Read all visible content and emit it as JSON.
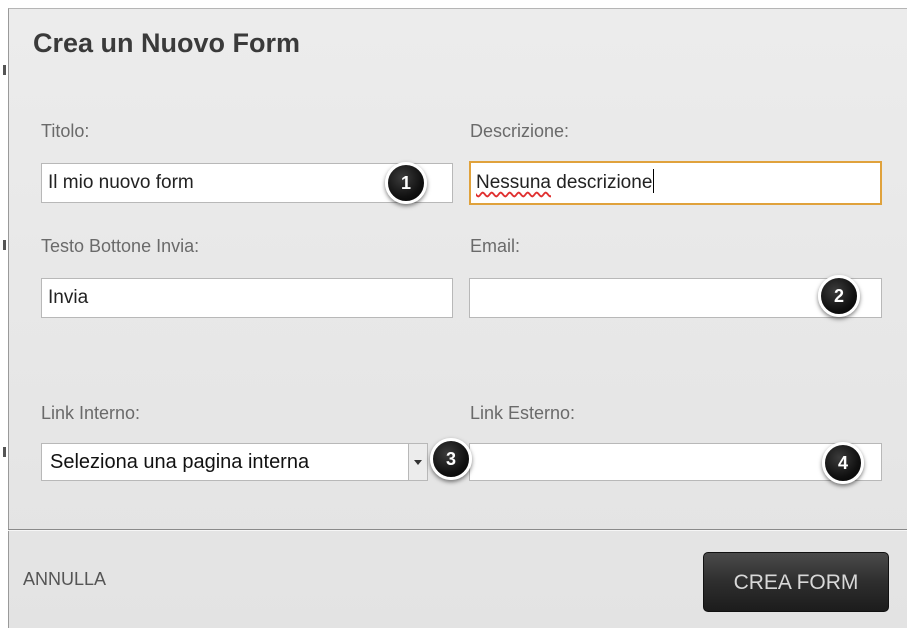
{
  "dialog": {
    "title": "Crea un Nuovo Form"
  },
  "fields": {
    "titolo": {
      "label": "Titolo:",
      "value": "Il mio nuovo form"
    },
    "descrizione": {
      "label": "Descrizione:",
      "value_part1": "Nessuna",
      "value_part2": " descrizione"
    },
    "testo_bottone": {
      "label": "Testo Bottone Invia:",
      "value": "Invia"
    },
    "email": {
      "label": "Email:",
      "value": ""
    },
    "link_interno": {
      "label": "Link Interno:",
      "selected": "Seleziona una pagina interna"
    },
    "link_esterno": {
      "label": "Link Esterno:",
      "value": ""
    }
  },
  "badges": [
    "1",
    "2",
    "3",
    "4"
  ],
  "footer": {
    "cancel_label": "ANNULLA",
    "submit_label": "CREA FORM"
  },
  "colors": {
    "focus_border": "#e0a23c",
    "button_bg": "#2e2e2e"
  }
}
